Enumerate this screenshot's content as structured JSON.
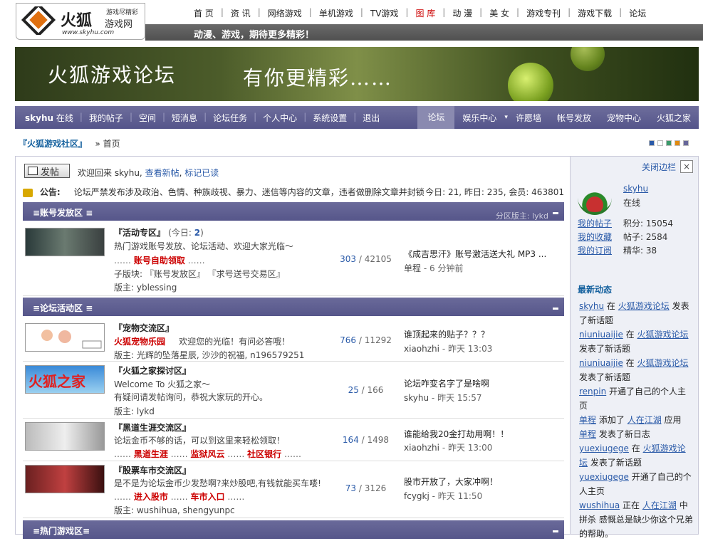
{
  "logo": {
    "name": "火狐",
    "tag": "游戏尽精彩",
    "sub": "游戏网",
    "url": "www.skyhu.com"
  },
  "topnav": {
    "items": [
      "首 页",
      "资 讯",
      "网络游戏",
      "单机游戏",
      "TV游戏",
      "图 库",
      "动 漫",
      "美 女",
      "游戏专刊",
      "游戏下载",
      "论坛"
    ],
    "highlight_index": 5,
    "slogan": "动漫、游戏，期待更多精彩！"
  },
  "banner": {
    "title": "火狐游戏论坛",
    "tagline": "有你更精彩……"
  },
  "mainnav": {
    "user": "skyhu",
    "status": "在线",
    "left": [
      "我的帖子",
      "空间",
      "短消息",
      "论坛任务",
      "个人中心",
      "系统设置",
      "退出"
    ],
    "right": [
      "论坛",
      "娱乐中心",
      "许愿墙",
      "帐号发放",
      "宠物中心",
      "火狐之家"
    ]
  },
  "breadcrumb": {
    "home": "『火狐游戏社区』",
    "current": "» 首页"
  },
  "swatches": [
    "#2a5aa8",
    "#ffffff",
    "#3a9a6a",
    "#e08a10",
    "#66669a"
  ],
  "toolbar": {
    "post_label": "发帖",
    "welcome_prefix": "欢迎回来",
    "user": "skyhu,",
    "new_posts": "查看新帖",
    "mark_read": "标记已读"
  },
  "notice": {
    "label": "公告:",
    "text": "论坛严禁发布涉及政治、色情、种族歧视、暴力、迷信等内容的文章，违者做删除文章并封锁",
    "stats": "今日: 21, 昨日: 235, 会员: 463801"
  },
  "categories": [
    {
      "title": "≡账号发放区 ≡",
      "moderator": "分区版主: lykd"
    },
    {
      "title": "≡论坛活动区 ≡",
      "moderator": ""
    },
    {
      "title": "≡热门游戏区≡",
      "moderator": ""
    }
  ],
  "forums": [
    {
      "name": "『活动专区』",
      "today_label": "(今日:",
      "today": "2",
      "today_close": ")",
      "desc": "热门游戏账号发放、论坛活动、欢迎大家光临～",
      "links": "账号自助领取",
      "sub": "子版块: 『账号发放区』 『求号送号交易区』",
      "mod": "版主: yblessing",
      "threads": "303",
      "posts": "42105",
      "last_title": "《成吉思汗》账号激活送大礼  MP3 ...",
      "last_user": "单程",
      "last_time": "- 6 分钟前"
    },
    {
      "name": "『宠物交流区』",
      "desc_red": "火狐宠物乐园",
      "desc": "欢迎您的光临！有问必答哦！",
      "mod": "版主: 光辉的坠落星辰, 沙沙的祝福, n196579251",
      "threads": "766",
      "posts": "11292",
      "last_title": "谁顶起来的贴子？？？",
      "last_user": "xiaohzhi",
      "last_time": "- 昨天 13:03"
    },
    {
      "name": "『火狐之家探讨区』",
      "desc": "Welcome To 火狐之家～",
      "desc2": "有疑问请发帖询问，恭祝大家玩的开心。",
      "mod": "版主: lykd",
      "threads": "25",
      "posts": "166",
      "last_title": "论坛咋变名字了是啥啊",
      "last_user": "skyhu",
      "last_time": "- 昨天 15:57"
    },
    {
      "name": "『黑道生涯交流区』",
      "desc": "论坛金币不够的话，可以到这里来轻松领取！",
      "links": [
        "黑道生涯",
        "监狱风云",
        "社区银行"
      ],
      "threads": "164",
      "posts": "1498",
      "last_title": "谁能给我20金打劫用啊！！",
      "last_user": "xiaohzhi",
      "last_time": "- 昨天 13:00"
    },
    {
      "name": "『股票车市交流区』",
      "desc": "是不是为论坛金币少发愁啊?来炒股吧,有钱就能买车喽!",
      "links": [
        "进入股市",
        "车市入口"
      ],
      "mod": "版主: wushihua, shengyunpc",
      "threads": "73",
      "posts": "3126",
      "last_title": "股市开放了，大家冲啊！",
      "last_user": "fcygkj",
      "last_time": "- 昨天 11:50"
    }
  ],
  "sidebar": {
    "close_label": "关闭边栏",
    "close_x": "×",
    "user": "skyhu",
    "status": "在线",
    "links": [
      "我的帖子",
      "我的收藏",
      "我的订阅"
    ],
    "points": [
      "积分: 15054",
      "帖子: 2584",
      "精华: 38"
    ],
    "feed_title": "最新动态",
    "feed": [
      {
        "u": "skyhu",
        "a": "在",
        "t": "火狐游戏论坛",
        "b": "发表了新话题"
      },
      {
        "u": "niuniuaijie",
        "a": "在",
        "t": "火狐游戏论坛",
        "b": "发表了新话题"
      },
      {
        "u": "niuniuaijie",
        "a": "在",
        "t": "火狐游戏论坛",
        "b": "发表了新话题"
      },
      {
        "u": "renpin",
        "a": "开通了自己的个人主页",
        "t": "",
        "b": ""
      },
      {
        "u": "单程",
        "a": "添加了",
        "t": "人在江湖",
        "b": "应用"
      },
      {
        "u": "单程",
        "a": "发表了新日志",
        "t": "",
        "b": ""
      },
      {
        "u": "yuexiugege",
        "a": "在",
        "t": "火狐游戏论坛",
        "b": "发表了新话题"
      },
      {
        "u": "yuexiugege",
        "a": "开通了自己的个人主页",
        "t": "",
        "b": ""
      },
      {
        "u": "wushihua",
        "a": "正在",
        "t": "人在江湖",
        "b": "中拼杀 感慨总是缺少你这个兄弟的帮助。"
      }
    ]
  }
}
